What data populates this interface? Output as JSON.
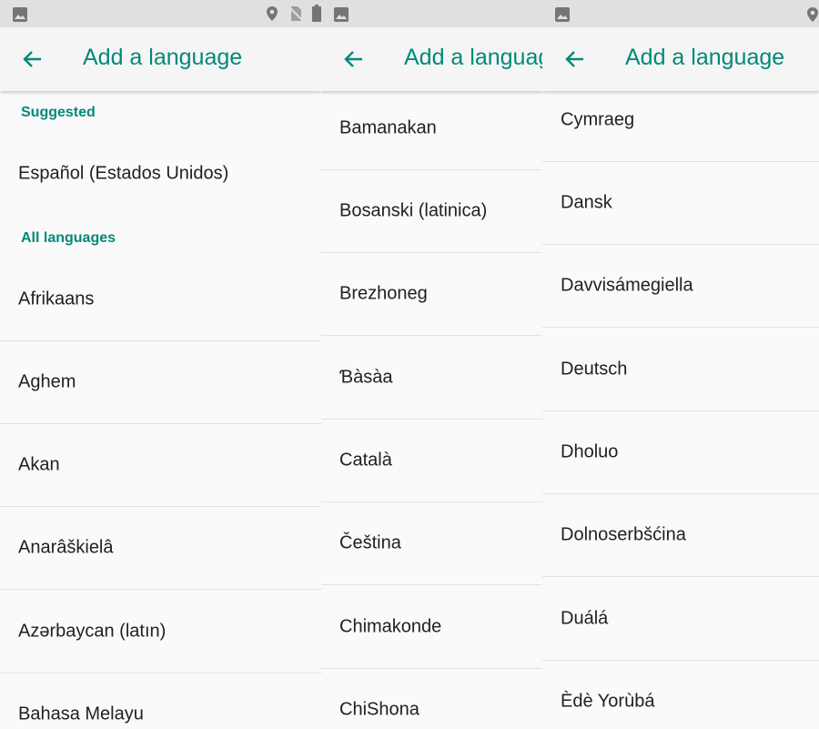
{
  "colors": {
    "accent": "#00897b",
    "status_bar": "#e0e0e0",
    "app_bar": "#f5f5f5",
    "text": "#212121"
  },
  "panel1": {
    "title": "Add a language",
    "suggested_header": "Suggested",
    "suggested": "Español (Estados Unidos)",
    "all_header": "All languages",
    "items": [
      "Afrikaans",
      "Aghem",
      "Akan",
      "Anarâškielâ",
      "Azərbaycan (latın)",
      "Bahasa Melayu"
    ]
  },
  "panel2": {
    "title": "Add a language",
    "items": [
      "Bamanakan",
      "Bosanski (latinica)",
      "Brezhoneg",
      "Ɓàsàa",
      "Català",
      "Čeština",
      "Chimakonde",
      "ChiShona"
    ]
  },
  "panel3": {
    "title": "Add a language",
    "items": [
      "Cymraeg",
      "Dansk",
      "Davvisámegiella",
      "Deutsch",
      "Dholuo",
      "Dolnoserbšćina",
      "Duálá",
      "Èdè Yorùbá"
    ]
  },
  "icons": {
    "gallery": "image-icon",
    "location": "location-pin-icon",
    "no_sim": "no-sim-icon",
    "battery": "battery-icon",
    "back": "arrow-back-icon"
  }
}
